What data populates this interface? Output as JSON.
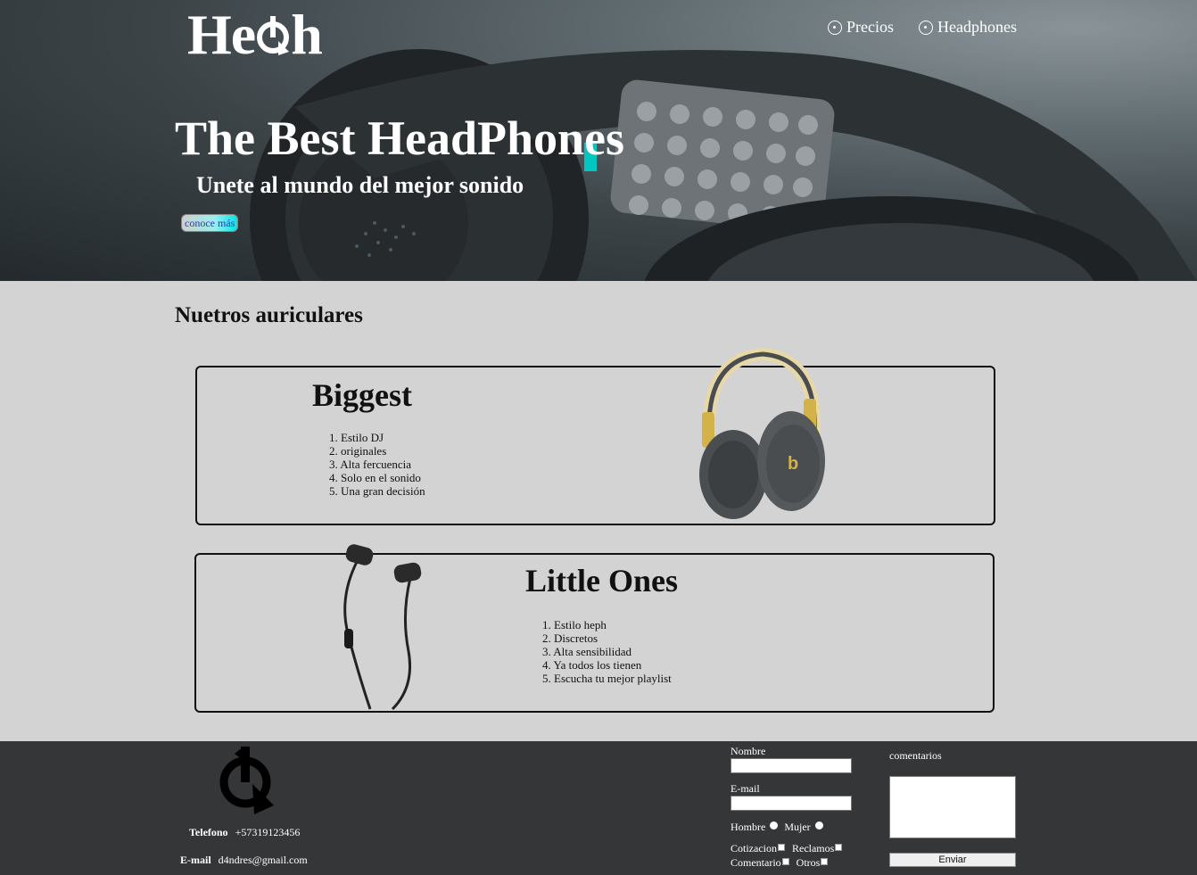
{
  "header": {
    "logo_text": "He",
    "logo_tail": "h",
    "nav": [
      {
        "label": "Precios",
        "icon": "circle-dot-icon"
      },
      {
        "label": "Headphones",
        "icon": "circle-dot-icon"
      }
    ]
  },
  "hero": {
    "title": "The Best HeadPhones",
    "subtitle": "Unete al mundo del mejor sonido",
    "cta_label": "conoce más"
  },
  "products": {
    "section_title": "Nuetros auriculares",
    "items": [
      {
        "name": "Biggest",
        "features": [
          "1. Estilo DJ",
          "2. originales",
          "3. Alta fercuencia",
          "4. Solo en el sonido",
          "5. Una gran decisión"
        ],
        "image": "over-ear-headphones-image"
      },
      {
        "name": "Little Ones",
        "features": [
          "1. Estilo heph",
          "2. Discretos",
          "3. Alta sensibilidad",
          "4. Ya todos los tienen",
          "5. Escucha tu mejor playlist"
        ],
        "image": "earbuds-image"
      }
    ]
  },
  "footer": {
    "phone_label": "Telefono",
    "phone_value": "+57319123456",
    "email_label": "E-mail",
    "email_value": "d4ndres@gmail.com",
    "form": {
      "name_label": "Nombre",
      "email_label": "E-mail",
      "gender_male": "Hombre",
      "gender_female": "Mujer",
      "checkboxes": [
        "Cotizacion",
        "Reclamos",
        "Comentario",
        "Otros"
      ],
      "comments_label": "comentarios",
      "submit_label": "Enviar"
    }
  },
  "colors": {
    "footer_bg": "#343638",
    "page_bg": "#d3d3d3",
    "hero_accent": "#00c8c0"
  }
}
